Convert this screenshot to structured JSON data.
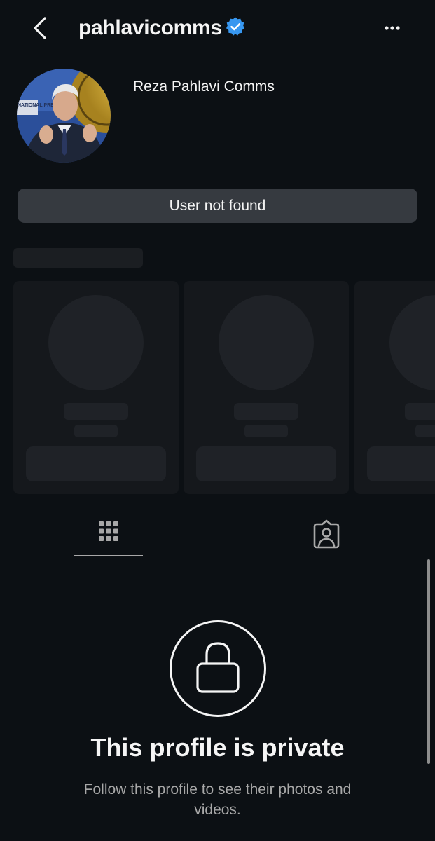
{
  "header": {
    "username": "pahlavicomms",
    "verified": true,
    "back_icon": "chevron-left-icon",
    "more_icon": "more-horizontal-icon"
  },
  "profile": {
    "display_name": "Reza Pahlavi Comms",
    "avatar": {
      "description_icon": "profile-photo",
      "banner_text": "NATIONAL PRESS C"
    }
  },
  "status": {
    "label": "User not found"
  },
  "tabs": [
    {
      "name": "posts-grid",
      "icon": "grid-icon",
      "active": true
    },
    {
      "name": "tagged",
      "icon": "tagged-person-icon",
      "active": false
    }
  ],
  "private_notice": {
    "icon": "lock-icon",
    "title": "This profile is private",
    "subtitle": "Follow this profile to see their photos and videos."
  },
  "colors": {
    "background": "#0c1014",
    "verified_badge": "#3797f0",
    "status_bar": "#363a40",
    "text_primary": "#f5f5f5",
    "text_secondary": "#a8a8a8"
  }
}
